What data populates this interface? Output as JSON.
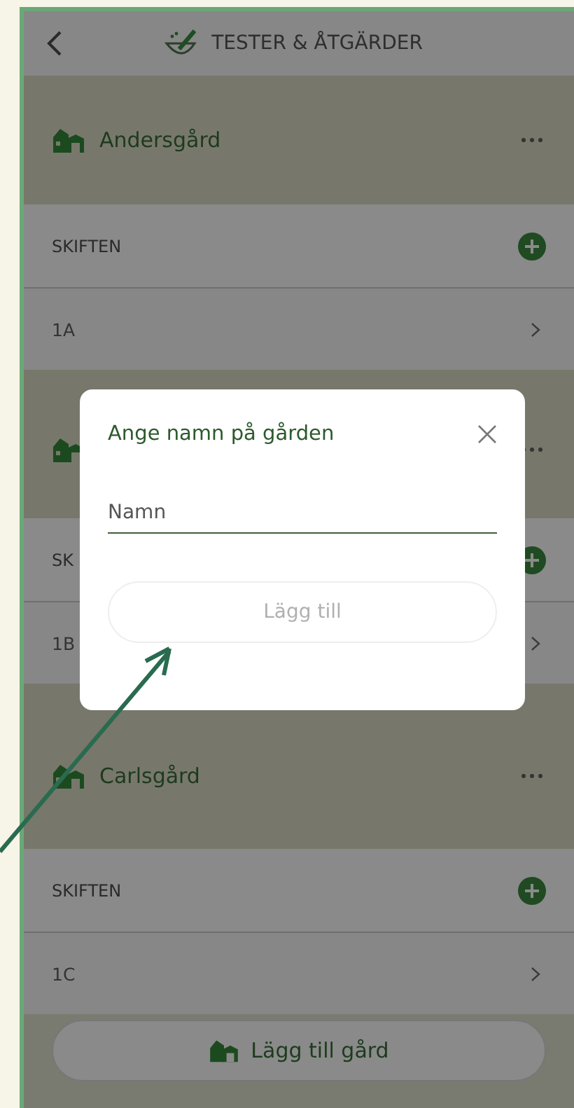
{
  "header": {
    "title": "TESTER & ÅTGÄRDER"
  },
  "farms": [
    {
      "name": "Andersgård",
      "section_label": "SKIFTEN",
      "fields": [
        {
          "name": "1A"
        }
      ]
    },
    {
      "section_label": "SK",
      "fields": [
        {
          "name": "1B"
        }
      ]
    },
    {
      "name": "Carlsgård",
      "section_label": "SKIFTEN",
      "fields": [
        {
          "name": "1C"
        }
      ]
    }
  ],
  "add_farm_button": {
    "label": "Lägg till gård"
  },
  "dialog": {
    "title": "Ange namn på gården",
    "placeholder": "Namn",
    "button": {
      "label": "Lägg till",
      "disabled": true
    }
  }
}
